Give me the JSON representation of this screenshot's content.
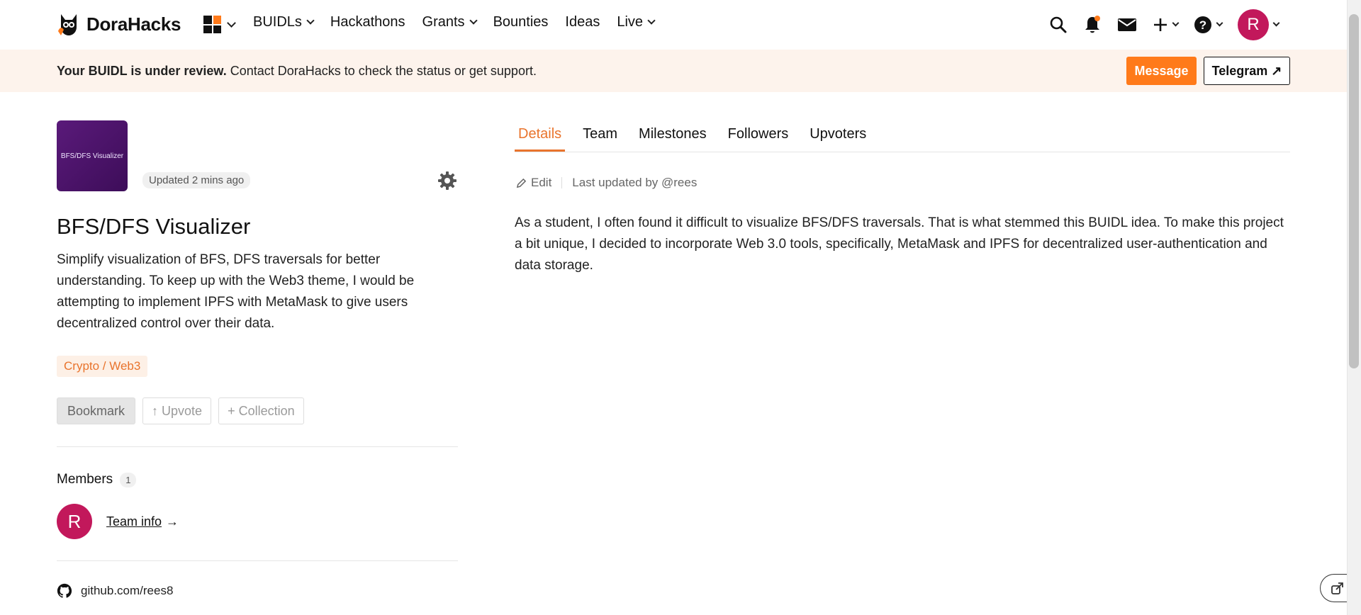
{
  "nav": {
    "brand": "DoraHacks",
    "menu": [
      {
        "label": "BUIDLs",
        "has_dropdown": true
      },
      {
        "label": "Hackathons",
        "has_dropdown": false
      },
      {
        "label": "Grants",
        "has_dropdown": true
      },
      {
        "label": "Bounties",
        "has_dropdown": false
      },
      {
        "label": "Ideas",
        "has_dropdown": false
      },
      {
        "label": "Live",
        "has_dropdown": true
      }
    ],
    "icons": [
      "search-icon",
      "bell-icon",
      "mail-icon",
      "plus-icon",
      "help-icon"
    ],
    "user_initial": "R",
    "notification_dot_color": "#ff7a1a"
  },
  "banner": {
    "bold": "Your BUIDL is under review.",
    "text": " Contact DoraHacks to check the status or get support.",
    "message_label": "Message",
    "telegram_label": "Telegram ↗"
  },
  "buidl": {
    "thumb_text": "BFS/DFS Visualizer",
    "updated": "Updated 2 mins ago",
    "title": "BFS/DFS Visualizer",
    "description": "Simplify visualization of BFS, DFS traversals for better understanding. To keep up with the Web3 theme, I would be attempting to implement IPFS with MetaMask to give users decentralized control over their data.",
    "tag": "Crypto / Web3",
    "bookmark_label": "Bookmark",
    "upvote_label": "↑ Upvote",
    "collection_label": "+ Collection",
    "members_label": "Members",
    "members_count": "1",
    "member_initial": "R",
    "team_info_label": "Team info",
    "team_info_arrow": "→",
    "github": "github.com/rees8"
  },
  "tabs": [
    {
      "label": "Details",
      "active": true
    },
    {
      "label": "Team",
      "active": false
    },
    {
      "label": "Milestones",
      "active": false
    },
    {
      "label": "Followers",
      "active": false
    },
    {
      "label": "Upvoters",
      "active": false
    }
  ],
  "details": {
    "edit_label": "Edit",
    "last_updated": "Last updated by @rees",
    "body": "As a student, I often found it difficult to visualize BFS/DFS traversals. That is what stemmed this BUIDL idea. To make this project a bit unique, I decided to incorporate Web 3.0 tools, specifically, MetaMask and IPFS for decentralized user-authentication and data storage."
  },
  "colors": {
    "accent": "#ff7a1a",
    "tag_text": "#e9742d",
    "avatar": "#c2185b",
    "banner_bg": "#fdf3ec"
  }
}
